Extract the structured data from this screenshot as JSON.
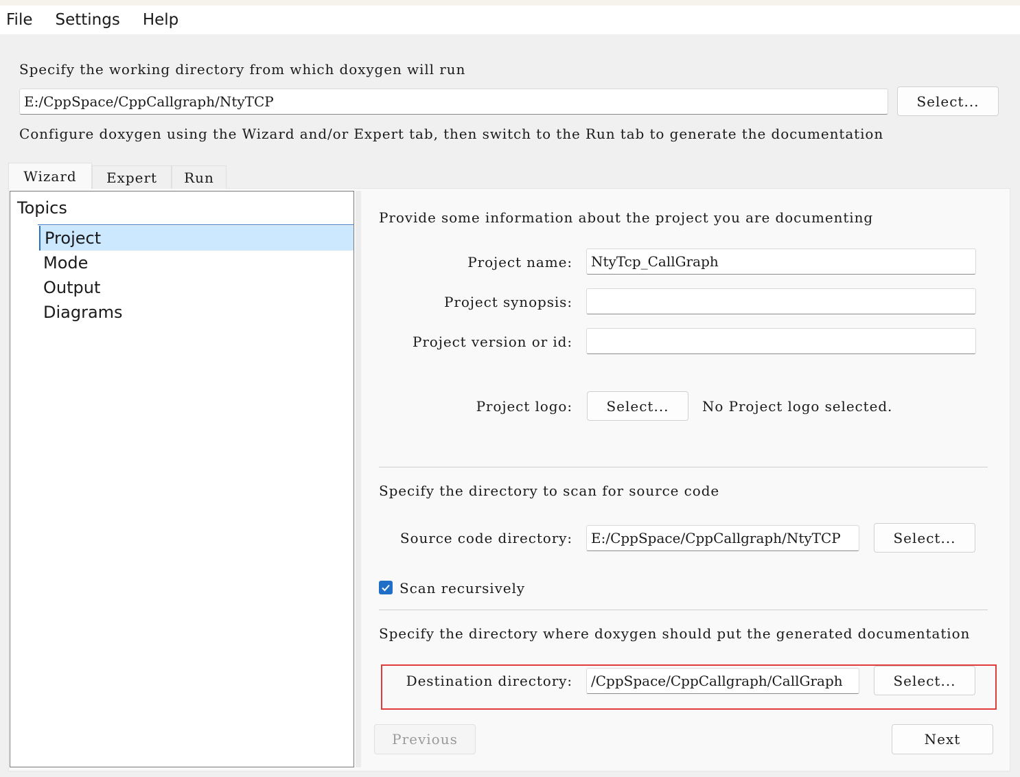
{
  "menubar": {
    "items": [
      "File",
      "Settings",
      "Help"
    ]
  },
  "header": {
    "working_dir_label": "Specify the working directory from which doxygen will run",
    "working_dir_value": "E:/CppSpace/CppCallgraph/NtyTCP",
    "select_label": "Select...",
    "hint": "Configure doxygen using the Wizard and/or Expert tab, then switch to the Run tab to generate the documentation"
  },
  "tabs": [
    {
      "label": "Wizard",
      "active": true
    },
    {
      "label": "Expert",
      "active": false
    },
    {
      "label": "Run",
      "active": false
    }
  ],
  "topics": {
    "title": "Topics",
    "items": [
      {
        "label": "Project",
        "selected": true
      },
      {
        "label": "Mode",
        "selected": false
      },
      {
        "label": "Output",
        "selected": false
      },
      {
        "label": "Diagrams",
        "selected": false
      }
    ]
  },
  "project": {
    "intro": "Provide some information about the project you are documenting",
    "name_label": "Project name:",
    "name_value": "NtyTcp_CallGraph",
    "synopsis_label": "Project synopsis:",
    "synopsis_value": "",
    "version_label": "Project version or id:",
    "version_value": "",
    "logo_label": "Project logo:",
    "logo_select": "Select...",
    "logo_status": "No Project logo selected."
  },
  "source": {
    "intro": "Specify the directory to scan for source code",
    "dir_label": "Source code directory:",
    "dir_value": "E:/CppSpace/CppCallgraph/NtyTCP",
    "select_label": "Select...",
    "scan_recursive_label": "Scan recursively",
    "scan_recursive_checked": true
  },
  "destination": {
    "intro": "Specify the directory where doxygen should put the generated documentation",
    "dir_label": "Destination directory:",
    "dir_value": "/CppSpace/CppCallgraph/CallGraph",
    "select_label": "Select..."
  },
  "nav": {
    "previous_label": "Previous",
    "next_label": "Next"
  },
  "colors": {
    "accent": "#1f6fc8",
    "selection": "#cce8ff",
    "highlight_border": "#e03a3a"
  }
}
